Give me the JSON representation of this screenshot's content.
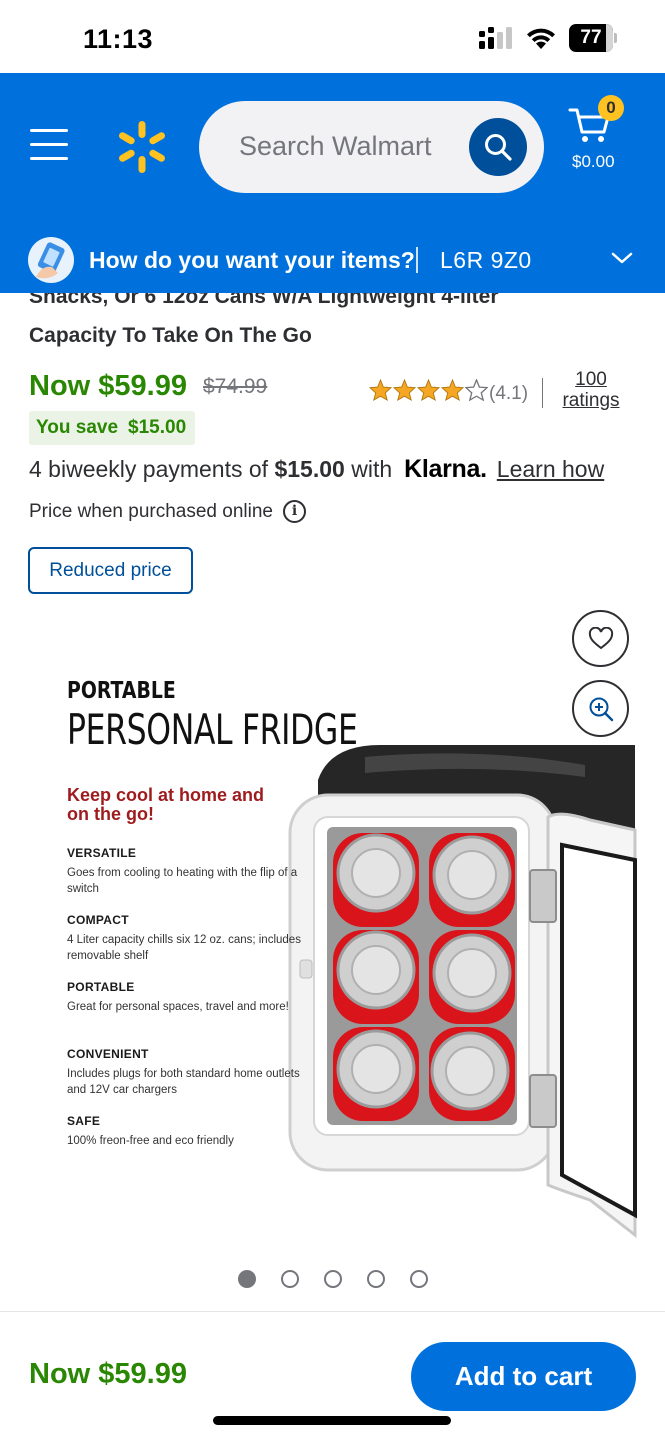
{
  "status_bar": {
    "time": "11:13",
    "battery": "77"
  },
  "header": {
    "search_placeholder": "Search Walmart",
    "cart_count": "0",
    "cart_total": "$0.00",
    "brand_color": "#0071dc",
    "spark_color": "#ffc220"
  },
  "delivery": {
    "question": "How do you want your items?",
    "postal_code": "L6R 9Z0"
  },
  "product": {
    "title_line_1": "Snacks, Or 6 12oz Cans W/A Lightweight 4-liter",
    "title_line_2": "Capacity To Take On The Go",
    "price_now": "Now $59.99",
    "price_was": "$74.99",
    "rating_value": "(4.1)",
    "rating_stars": 4.1,
    "ratings_count_number": "100",
    "ratings_count_label": "ratings",
    "save_label": "You save",
    "save_amount": "$15.00",
    "klarna_prefix": "4 biweekly payments of",
    "klarna_amount": "$15.00",
    "klarna_with": "with",
    "klarna_brand": "Klarna.",
    "klarna_link": "Learn how",
    "price_note": "Price when purchased online",
    "info_glyph": "i",
    "badge": "Reduced price",
    "price_color": "#2a8703"
  },
  "product_image": {
    "heading_small": "PORTABLE",
    "heading_large": "PERSONAL FRIDGE",
    "tagline": "Keep cool at home and on the go!",
    "features": [
      {
        "title": "VERSATILE",
        "desc": "Goes from cooling to heating with the flip of a switch"
      },
      {
        "title": "COMPACT",
        "desc": "4 Liter capacity chills six 12 oz. cans; includes removable shelf"
      },
      {
        "title": "PORTABLE",
        "desc": "Great for personal spaces, travel and more!"
      },
      {
        "title": "CONVENIENT",
        "desc": "Includes plugs for both standard home outlets and 12V car chargers"
      },
      {
        "title": "SAFE",
        "desc": "100% freon-free and eco friendly"
      }
    ],
    "carousel_total": 5,
    "carousel_active": 1
  },
  "footer": {
    "price": "Now $59.99",
    "add_to_cart": "Add to cart"
  }
}
